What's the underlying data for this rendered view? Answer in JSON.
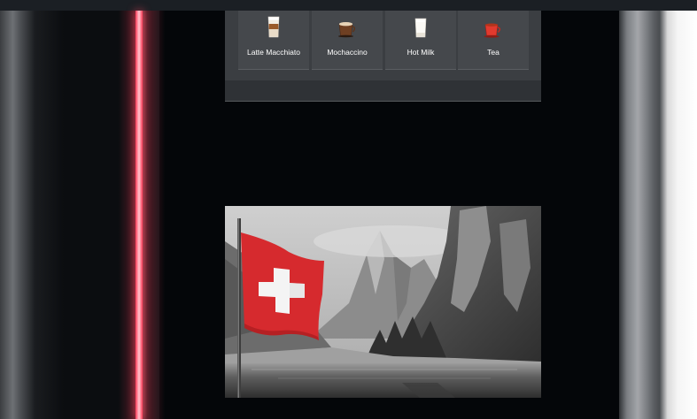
{
  "menu": {
    "items": [
      {
        "label": "Latte Macchiato",
        "icon": "latte-macchiato-glass-icon"
      },
      {
        "label": "Mochaccino",
        "icon": "mochaccino-cup-icon"
      },
      {
        "label": "Hot Milk",
        "icon": "hot-milk-glass-icon"
      },
      {
        "label": "Tea",
        "icon": "tea-cup-icon"
      }
    ]
  },
  "colors": {
    "accent_light": "#ff3a56",
    "panel": "#3b3e42",
    "tile": "#45484c",
    "screen_background": "#040609",
    "flag_red": "#d62a2e"
  },
  "banner_image": {
    "description_icon": "swiss-flag-mountain-lake-photo"
  }
}
